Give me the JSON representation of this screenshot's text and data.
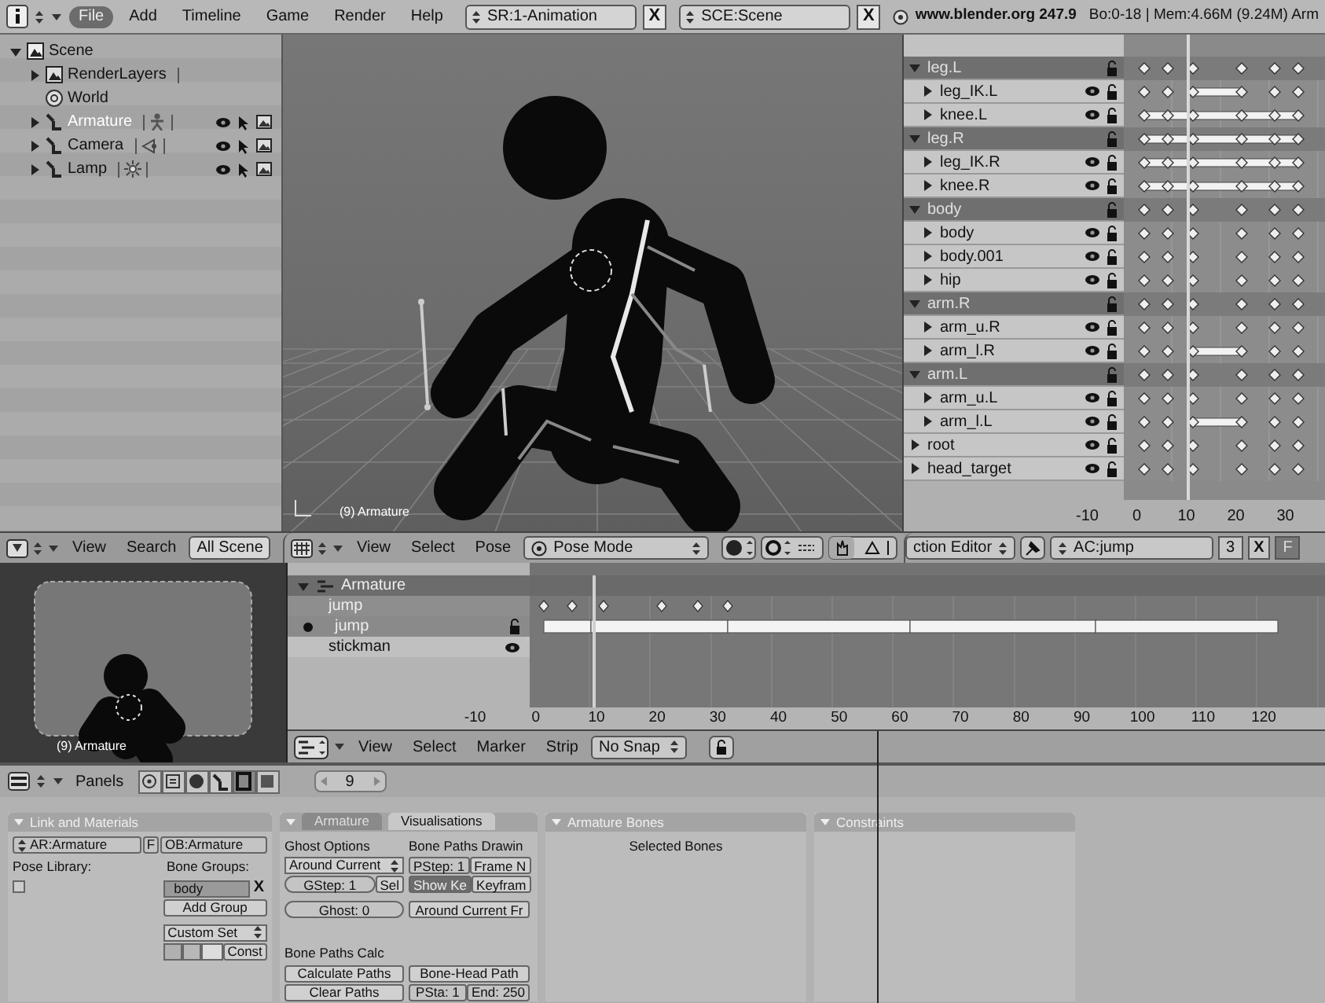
{
  "top_bar": {
    "menus": [
      {
        "label": "File",
        "selected": true
      },
      {
        "label": "Add",
        "selected": false
      },
      {
        "label": "Timeline",
        "selected": false
      },
      {
        "label": "Game",
        "selected": false
      },
      {
        "label": "Render",
        "selected": false
      },
      {
        "label": "Help",
        "selected": false
      }
    ],
    "screen": {
      "label": "SR:1-Animation",
      "close": "X"
    },
    "scene": {
      "label": "SCE:Scene",
      "close": "X"
    },
    "url": "www.blender.org 247.9",
    "stats": "Bo:0-18 | Mem:4.66M (9.24M) Arm"
  },
  "outliner": {
    "items": [
      {
        "label": "Scene",
        "kind": "scene",
        "expanded": true,
        "selected": false,
        "children": [
          {
            "label": "RenderLayers",
            "kind": "layers",
            "expanded": false,
            "selected": false
          },
          {
            "label": "World",
            "kind": "world",
            "selected": false
          },
          {
            "label": "Armature",
            "kind": "armature",
            "expanded": false,
            "selected": true
          },
          {
            "label": "Camera",
            "kind": "camera",
            "expanded": false,
            "selected": false
          },
          {
            "label": "Lamp",
            "kind": "lamp",
            "expanded": false,
            "selected": false
          }
        ]
      }
    ]
  },
  "viewport": {
    "label": "(9) Armature"
  },
  "action_editor": {
    "channels": [
      {
        "label": "leg.L",
        "kind": "group",
        "expanded": true,
        "short_hold": false,
        "full_hold": false,
        "children": [
          {
            "label": "leg_IK.L",
            "kind": "channel",
            "expanded": false,
            "short_hold": true,
            "full_hold": false
          },
          {
            "label": "knee.L",
            "kind": "channel",
            "expanded": false,
            "short_hold": false,
            "full_hold": true
          }
        ]
      },
      {
        "label": "leg.R",
        "kind": "group",
        "expanded": true,
        "short_hold": false,
        "full_hold": true,
        "children": [
          {
            "label": "leg_IK.R",
            "kind": "channel",
            "expanded": false,
            "short_hold": false,
            "full_hold": true
          },
          {
            "label": "knee.R",
            "kind": "channel",
            "expanded": false,
            "short_hold": false,
            "full_hold": true
          }
        ]
      },
      {
        "label": "body",
        "kind": "group",
        "expanded": true,
        "short_hold": false,
        "full_hold": false,
        "children": [
          {
            "label": "body",
            "kind": "channel",
            "expanded": false,
            "short_hold": false,
            "full_hold": false
          },
          {
            "label": "body.001",
            "kind": "channel",
            "expanded": false,
            "short_hold": false,
            "full_hold": false
          },
          {
            "label": "hip",
            "kind": "channel",
            "expanded": false,
            "short_hold": false,
            "full_hold": false
          }
        ]
      },
      {
        "label": "arm.R",
        "kind": "group",
        "expanded": true,
        "short_hold": false,
        "full_hold": false,
        "children": [
          {
            "label": "arm_u.R",
            "kind": "channel",
            "expanded": false,
            "short_hold": false,
            "full_hold": false
          },
          {
            "label": "arm_l.R",
            "kind": "channel",
            "expanded": false,
            "short_hold": true,
            "full_hold": false
          }
        ]
      },
      {
        "label": "arm.L",
        "kind": "group",
        "expanded": true,
        "short_hold": false,
        "full_hold": false,
        "children": [
          {
            "label": "arm_u.L",
            "kind": "channel",
            "expanded": false,
            "short_hold": false,
            "full_hold": false
          },
          {
            "label": "arm_l.L",
            "kind": "channel",
            "expanded": false,
            "short_hold": true,
            "full_hold": false
          }
        ]
      },
      {
        "label": "root",
        "kind": "channel",
        "expanded": false,
        "short_hold": false,
        "full_hold": false
      },
      {
        "label": "head_target",
        "kind": "channel",
        "expanded": false,
        "short_hold": false,
        "full_hold": false
      }
    ],
    "ruler": [
      "-10",
      "0",
      "10",
      "20",
      "30"
    ]
  },
  "outliner_header": {
    "menus": [
      "View",
      "Search"
    ],
    "field": "All Scene"
  },
  "viewport_header": {
    "menus": [
      "View",
      "Select",
      "Pose"
    ],
    "mode": "Pose Mode"
  },
  "action_header": {
    "editor": "ction Editor",
    "action": "AC:jump",
    "users": "3",
    "close": "X",
    "fake": "F"
  },
  "camera_view": {
    "label": "(9) Armature"
  },
  "nla": {
    "rows": [
      {
        "label": "Armature",
        "kind": "object",
        "selected": true
      },
      {
        "label": "jump",
        "kind": "action",
        "selected": false
      },
      {
        "label": "jump",
        "kind": "strip",
        "selected": true
      },
      {
        "label": "stickman",
        "kind": "strip",
        "selected": false
      }
    ],
    "ruler": [
      "-10",
      "0",
      "10",
      "20",
      "30",
      "40",
      "50",
      "60",
      "70",
      "80",
      "90",
      "100",
      "110",
      "120"
    ]
  },
  "nla_header": {
    "menus": [
      "View",
      "Select",
      "Marker",
      "Strip"
    ],
    "snap": "No Snap"
  },
  "buttons_header": {
    "label": "Panels",
    "frame": "9"
  },
  "link_panel": {
    "title": "Link and Materials",
    "armature": "AR:Armature",
    "fake": "F",
    "object": "OB:Armature",
    "pose_library": "Pose Library:",
    "bone_groups": "Bone Groups:",
    "group": "body",
    "remove": "X",
    "add_group": "Add Group",
    "color_set": "Custom Set",
    "const": "Const"
  },
  "armature_panel": {
    "tabs": [
      {
        "label": "Armature",
        "selected": false
      },
      {
        "label": "Visualisations",
        "selected": true
      }
    ],
    "ghost_title": "Ghost Options",
    "ghost_type": "Around Current",
    "gstep": "GStep: 1",
    "sel": "Sel",
    "ghost": "Ghost: 0",
    "paths_title": "Bone Paths Drawin",
    "pstep": "PStep: 1",
    "frame_n": "Frame N",
    "show_keys": {
      "label": "Show Ke",
      "on": true
    },
    "keyframe": "Keyfram",
    "paths_range": "Around Current Fr",
    "calc_title": "Bone Paths Calc",
    "calculate": "Calculate Paths",
    "head_path": "Bone-Head Path",
    "clear": "Clear Paths",
    "psta": "PSta: 1",
    "end": "End: 250"
  },
  "bones_panel": {
    "title": "Armature Bones",
    "text": "Selected Bones"
  },
  "constraints_panel": {
    "title": "Constraints"
  }
}
